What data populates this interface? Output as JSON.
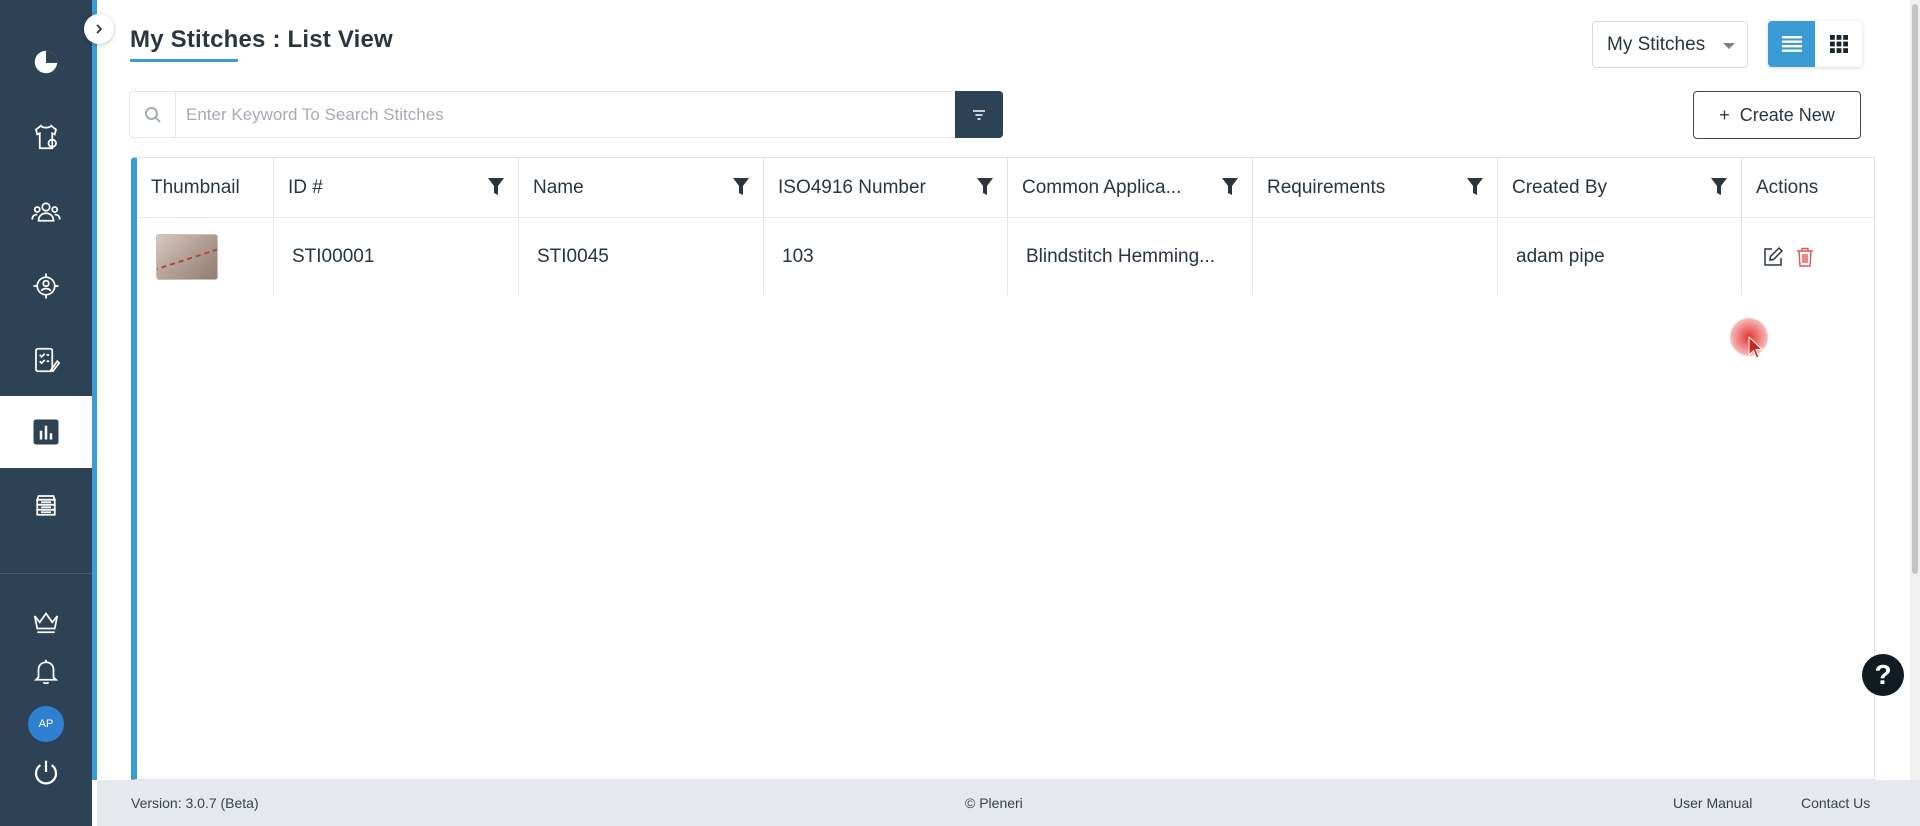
{
  "header": {
    "title": "My Stitches : List View",
    "dropdown_value": "My Stitches"
  },
  "search": {
    "placeholder": "Enter Keyword To Search Stitches"
  },
  "toolbar": {
    "create_label": "Create New",
    "create_plus": "+"
  },
  "sidebar": {
    "avatar_initials": "AP"
  },
  "table": {
    "columns": [
      "Thumbnail",
      "ID #",
      "Name",
      "ISO4916 Number",
      "Common Applica...",
      "Requirements",
      "Created By",
      "Actions"
    ],
    "rows": [
      {
        "id": "STI00001",
        "name": "STI0045",
        "iso": "103",
        "application": "Blindstitch Hemming...",
        "requirements": "",
        "created_by": "adam pipe"
      }
    ]
  },
  "help": {
    "label": "?"
  },
  "footer": {
    "version": "Version: 3.0.7 (Beta)",
    "copyright": "© Pleneri",
    "manual": "User Manual",
    "contact": "Contact Us"
  },
  "colors": {
    "sidebar": "#2d4255",
    "accent": "#3a9bd5",
    "delete": "#e05555"
  }
}
